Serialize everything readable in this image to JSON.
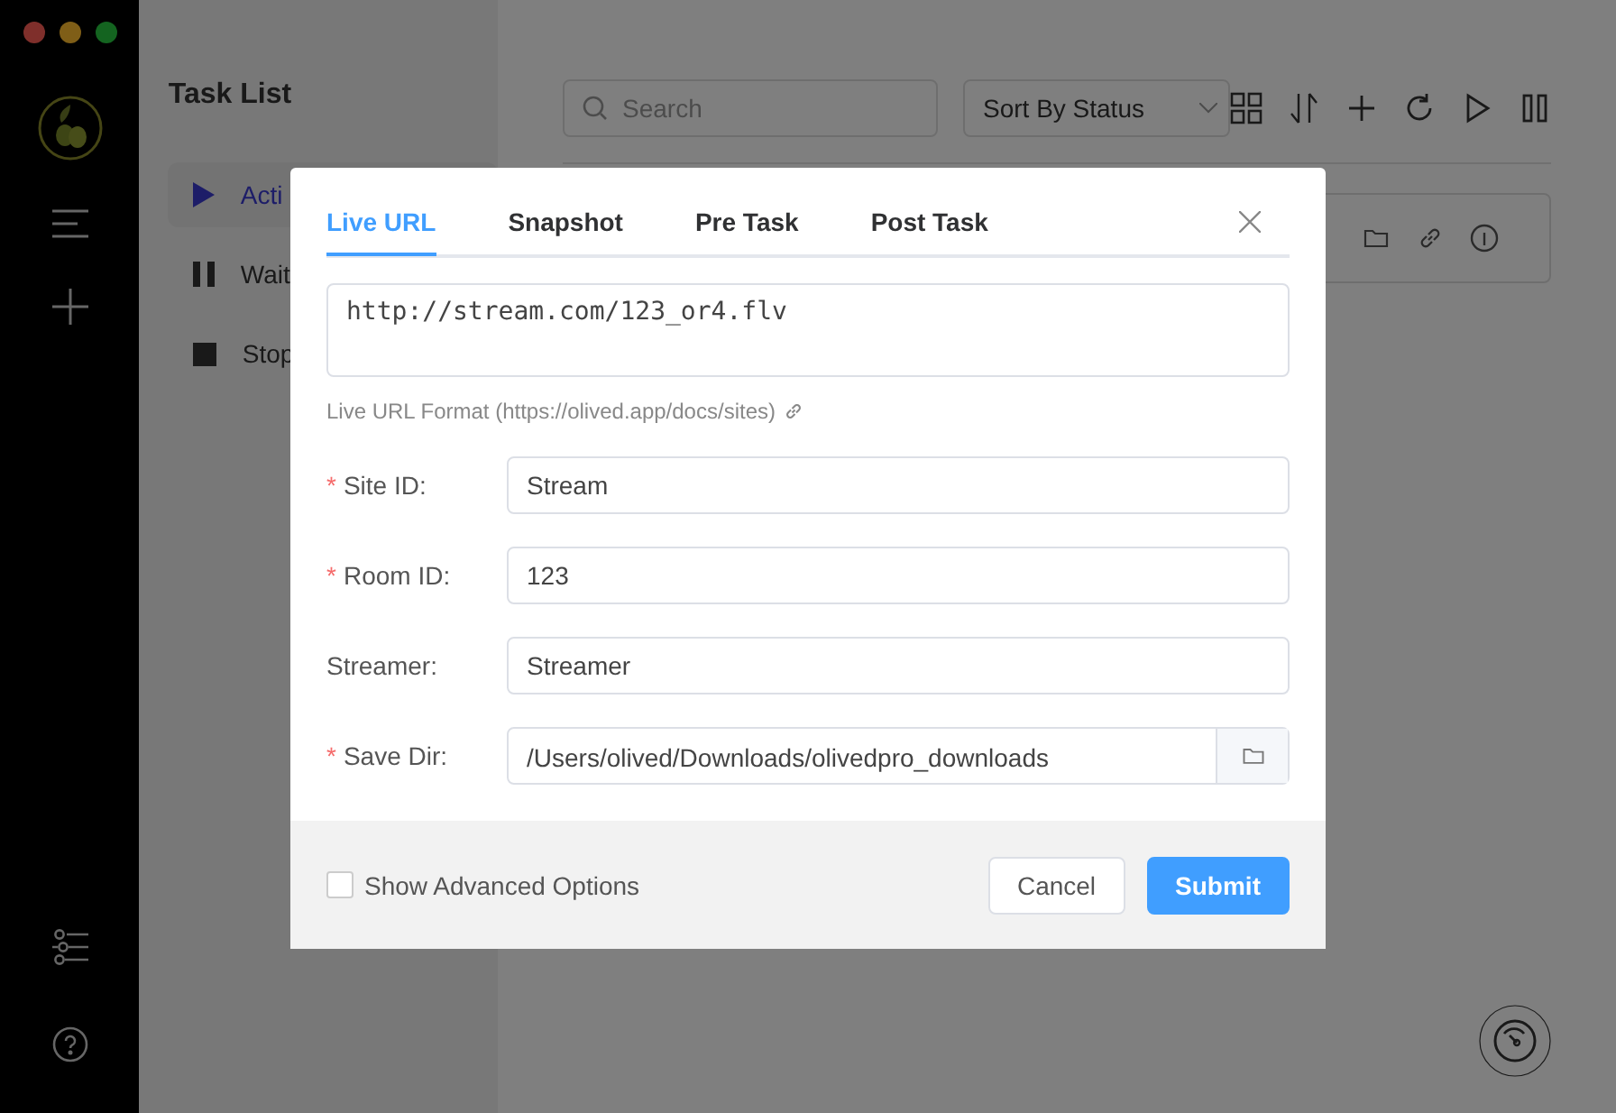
{
  "task_panel": {
    "title": "Task List",
    "filters": [
      {
        "label": "Acti",
        "kind": "play",
        "selected": true
      },
      {
        "label": "Wait",
        "kind": "pause",
        "selected": false
      },
      {
        "label": "Stop",
        "kind": "stop",
        "selected": false
      }
    ]
  },
  "toolbar": {
    "search": {
      "placeholder": "Search"
    },
    "sort": {
      "value": "Sort By Status"
    }
  },
  "dialog": {
    "tabs": [
      {
        "label": "Live URL",
        "selected": true
      },
      {
        "label": "Snapshot",
        "selected": false
      },
      {
        "label": "Pre Task",
        "selected": false
      },
      {
        "label": "Post Task",
        "selected": false
      }
    ],
    "url": {
      "value": "http://stream.com/123_or4.flv"
    },
    "format_hint": "Live URL Format (https://olived.app/docs/sites)",
    "fields": [
      {
        "label": "Site ID:",
        "value": "Stream",
        "required_mark": "*",
        "kind": "text"
      },
      {
        "label": "Room ID:",
        "value": "123",
        "required_mark": "*",
        "kind": "text"
      },
      {
        "label": "Streamer:",
        "value": "Streamer",
        "kind": "text"
      },
      {
        "label": "Save Dir:",
        "value": "/Users/olived/Downloads/olivedpro_downloads",
        "required_mark": "*",
        "kind": "folder"
      }
    ],
    "advanced": {
      "label": "Show Advanced Options",
      "checked": false
    },
    "buttons": [
      {
        "label": "Cancel",
        "kind": "default"
      },
      {
        "label": "Submit",
        "kind": "primary"
      }
    ]
  }
}
